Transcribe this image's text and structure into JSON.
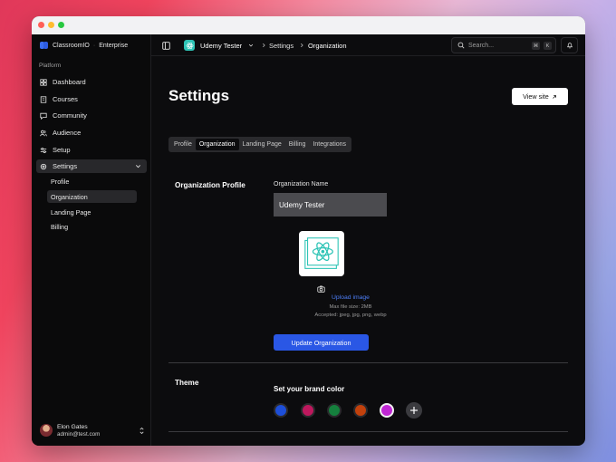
{
  "app": {
    "name": "ClassroomIO",
    "plan": "Enterprise"
  },
  "sidebar": {
    "section_label": "Platform",
    "items": [
      {
        "label": "Dashboard",
        "icon": "dashboard-icon"
      },
      {
        "label": "Courses",
        "icon": "courses-icon"
      },
      {
        "label": "Community",
        "icon": "community-icon"
      },
      {
        "label": "Audience",
        "icon": "audience-icon"
      },
      {
        "label": "Setup",
        "icon": "setup-icon"
      },
      {
        "label": "Settings",
        "icon": "settings-icon",
        "active": true
      }
    ],
    "settings_subitems": [
      {
        "label": "Profile"
      },
      {
        "label": "Organization",
        "active": true
      },
      {
        "label": "Landing Page"
      },
      {
        "label": "Billing"
      }
    ],
    "user": {
      "name": "Elon Gates",
      "email": "admin@test.com"
    }
  },
  "topbar": {
    "course_name": "Udemy Tester",
    "breadcrumb": [
      "Settings",
      "Organization"
    ],
    "search_placeholder": "Search...",
    "shortcut_keys": [
      "⌘",
      "K"
    ]
  },
  "page": {
    "title": "Settings",
    "view_site_label": "View site",
    "tabs": [
      {
        "label": "Profile"
      },
      {
        "label": "Organization",
        "active": true
      },
      {
        "label": "Landing Page"
      },
      {
        "label": "Billing"
      },
      {
        "label": "Integrations"
      }
    ]
  },
  "organization": {
    "section_title": "Organization Profile",
    "name_label": "Organization Name",
    "name_value": "Udemy Tester",
    "upload_label": "Upload image",
    "max_size_hint": "Max file size: 2MB",
    "accepted_hint": "Accepted: jpeg, jpg, png, webp",
    "update_button_label": "Update Organization"
  },
  "theme": {
    "section_title": "Theme",
    "brand_color_label": "Set your brand color",
    "colors": [
      "#1d4ed8",
      "#be185d",
      "#15803d",
      "#c2410c",
      "#c026d3"
    ],
    "selected_color": "#c026d3"
  },
  "colors": {
    "accent": "#2a57e5",
    "link": "#4d7ef7",
    "background": "#0c0c0e",
    "course_badge": "#2ec4b6"
  }
}
